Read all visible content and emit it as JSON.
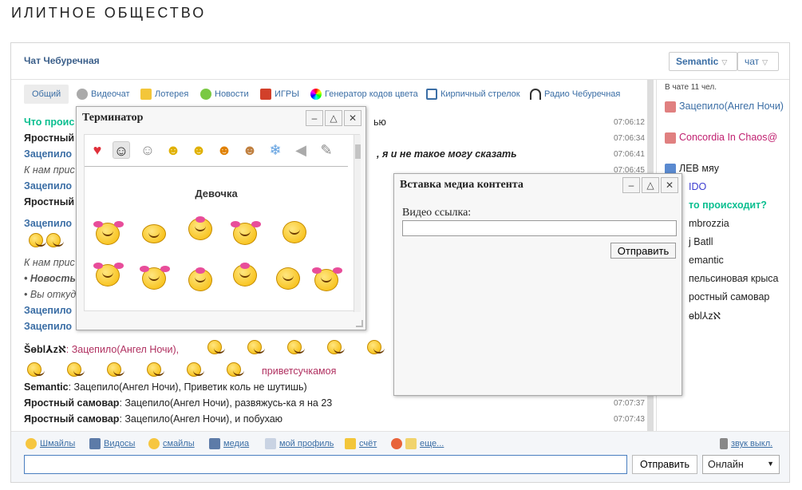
{
  "site_title": "ИЛИТНОЕ ОБЩЕСТВО",
  "chat": {
    "name": "Чат Чебуречная",
    "mode": "Semantic",
    "room": "чат"
  },
  "tabs": [
    {
      "label": "Общий",
      "icon": "general-tab"
    },
    {
      "label": "Видеочат",
      "icon": "webcam-icon"
    },
    {
      "label": "Лотерея",
      "icon": "lottery-icon"
    },
    {
      "label": "Новости",
      "icon": "news-icon"
    },
    {
      "label": "ИГРЫ",
      "icon": "games-icon"
    },
    {
      "label": "Генератор кодов цвета",
      "icon": "color-wheel-icon"
    },
    {
      "label": "Кирпичный стрелок",
      "icon": "brick-icon"
    },
    {
      "label": "Радио Чебуречная",
      "icon": "headphones-icon"
    }
  ],
  "messages": [
    {
      "nick": "Что проис",
      "text": "",
      "tail": "ью",
      "time": "07:06:12"
    },
    {
      "nick": "Яростный",
      "text": "",
      "tail": "",
      "time": "07:06:34"
    },
    {
      "nick": "Зацепило",
      "text": "",
      "tail": ", я и не такое могу сказать",
      "time": "07:06:41"
    },
    {
      "nick": "",
      "text": "К нам прис",
      "tail": "",
      "time": "07:06:45"
    },
    {
      "nick": "Зацепило",
      "text": "",
      "tail": "",
      "time": ""
    },
    {
      "nick": "Яростный",
      "text": "",
      "tail": "",
      "time": ""
    },
    {
      "nick": "Зацепило",
      "text": "",
      "tail": "",
      "time": ""
    },
    {
      "nick": "",
      "text": "К нам прис",
      "tail": "",
      "time": ""
    },
    {
      "nick": "",
      "text": "Новость",
      "tail": "",
      "time": ""
    },
    {
      "nick": "",
      "text": "Вы откуда",
      "tail": "",
      "time": ""
    },
    {
      "nick": "Зацепило",
      "text": "",
      "tail": "",
      "time": ""
    },
    {
      "nick": "Зацепило",
      "text": "",
      "tail": "",
      "time": ""
    },
    {
      "nick": "Šɵbl⅄zℵ",
      "text": ": Зацепило(Ангел Ночи),",
      "tail": "",
      "time": ""
    },
    {
      "nick": "",
      "text": "приветсучкамоя",
      "tail": "",
      "time": ""
    },
    {
      "nick": "Semantic",
      "text": ": Зацепило(Ангел Ночи), Приветик коль не шутишь)",
      "tail": "",
      "time": ""
    },
    {
      "nick": "Яростный самовар",
      "text": ": Зацепило(Ангел Ночи), развяжусь-ка я на 23",
      "tail": "",
      "time": "07:07:37"
    },
    {
      "nick": "Яростный самовар",
      "text": ": Зацепило(Ангел Ночи), и побухаю",
      "tail": "",
      "time": "07:07:43"
    }
  ],
  "users_count": "В чате 11 чел.",
  "users": [
    "Зацепило(Ангел Ночи)",
    "Concordia In Chaos@",
    "ЛЕВ мяу",
    "IDO",
    "то происходит?",
    "mbrozzia",
    "j Batll",
    "emantic",
    "пельсиновая крыса",
    "ростный самовар",
    "ɵbl⅄zℵ"
  ],
  "toolbar": [
    {
      "label": "Шмайлы",
      "icon": "sunglasses-smile-icon"
    },
    {
      "label": "Видосы",
      "icon": "film-icon"
    },
    {
      "label": "смайлы",
      "icon": "smile-icon"
    },
    {
      "label": "медиа",
      "icon": "media-icon"
    },
    {
      "label": "мой профиль",
      "icon": "profile-icon"
    },
    {
      "label": "счёт",
      "icon": "coins-icon"
    },
    {
      "label": "еще...",
      "icon": "vip-icon"
    },
    {
      "label": "звук выкл.",
      "icon": "speaker-icon"
    }
  ],
  "input": {
    "value": "",
    "send_label": "Отправить",
    "status": "Онлайн"
  },
  "smile_window": {
    "title": "Терминатор",
    "group": "Девочка",
    "categories": [
      "heart",
      "hat-smile",
      "cat",
      "wink",
      "cool",
      "grin",
      "cow",
      "snowflake",
      "speaker",
      "wrench"
    ]
  },
  "media_window": {
    "title": "Вставка медиа контента",
    "label": "Видео ссылка:",
    "send_label": "Отправить"
  }
}
